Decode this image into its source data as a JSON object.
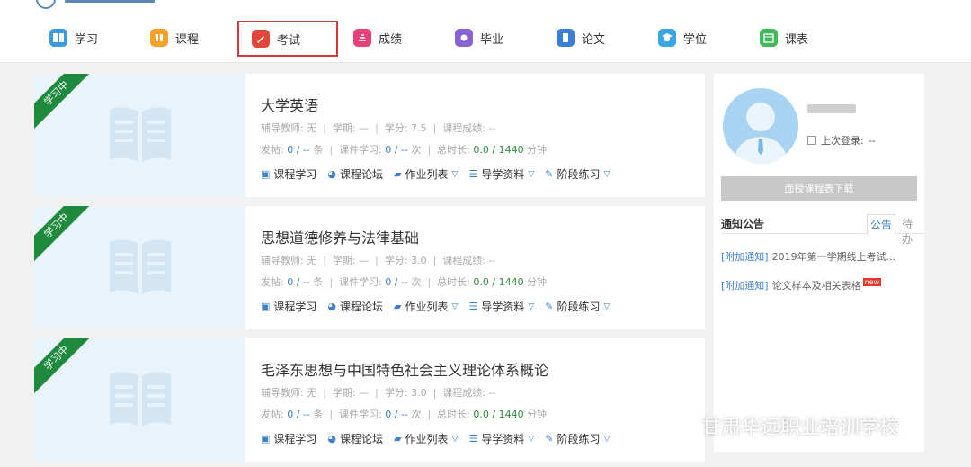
{
  "nav": {
    "items": [
      {
        "label": "学习",
        "icon": "book-icon",
        "color": "#3a9be0"
      },
      {
        "label": "课程",
        "icon": "course-icon",
        "color": "#f5a12a"
      },
      {
        "label": "考试",
        "icon": "pen-icon",
        "color": "#e0473a",
        "active": true
      },
      {
        "label": "成绩",
        "icon": "score-icon",
        "color": "#e63f7a"
      },
      {
        "label": "毕业",
        "icon": "graduation-icon",
        "color": "#8a63d2"
      },
      {
        "label": "论文",
        "icon": "paper-icon",
        "color": "#3a7fd5"
      },
      {
        "label": "学位",
        "icon": "cap-icon",
        "color": "#3aa5e0"
      },
      {
        "label": "课表",
        "icon": "calendar-icon",
        "color": "#43b85c"
      }
    ]
  },
  "courses": [
    {
      "status": "学习中",
      "title": "大学英语",
      "tutor_label": "辅导教师:",
      "tutor": "无",
      "term_label": "学期:",
      "term": "—",
      "credit_label": "学分:",
      "credit": "7.5",
      "grade_label": "课程成绩:",
      "grade": "--",
      "posts_label": "发帖:",
      "posts": "0 / --",
      "posts_unit": "条",
      "courseware_label": "课件学习:",
      "courseware": "0 / --",
      "courseware_unit": "次",
      "duration_label": "总时长:",
      "duration": "0.0 / 1440",
      "duration_unit": "分钟"
    },
    {
      "status": "学习中",
      "title": "思想道德修养与法律基础",
      "tutor_label": "辅导教师:",
      "tutor": "无",
      "term_label": "学期:",
      "term": "—",
      "credit_label": "学分:",
      "credit": "3.0",
      "grade_label": "课程成绩:",
      "grade": "--",
      "posts_label": "发帖:",
      "posts": "0 / --",
      "posts_unit": "条",
      "courseware_label": "课件学习:",
      "courseware": "0 / --",
      "courseware_unit": "次",
      "duration_label": "总时长:",
      "duration": "0.0 / 1440",
      "duration_unit": "分钟"
    },
    {
      "status": "学习中",
      "title": "毛泽东思想与中国特色社会主义理论体系概论",
      "tutor_label": "辅导教师:",
      "tutor": "无",
      "term_label": "学期:",
      "term": "—",
      "credit_label": "学分:",
      "credit": "3.0",
      "grade_label": "课程成绩:",
      "grade": "--",
      "posts_label": "发帖:",
      "posts": "0 / --",
      "posts_unit": "条",
      "courseware_label": "课件学习:",
      "courseware": "0 / --",
      "courseware_unit": "次",
      "duration_label": "总时长:",
      "duration": "0.0 / 1440",
      "duration_unit": "分钟"
    }
  ],
  "course_actions": {
    "study": "课程学习",
    "forum": "课程论坛",
    "homework": "作业列表",
    "guide": "导学资料",
    "practice": "阶段练习"
  },
  "sidebar": {
    "last_login_label": "上次登录:",
    "last_login_value": "--",
    "download_button": "面授课程表下载",
    "notice_title": "通知公告",
    "tab_announce": "公告",
    "tab_todo": "待办",
    "notices": [
      {
        "tag": "[附加通知]",
        "text": "2019年第一学期线上考试...",
        "is_new": false
      },
      {
        "tag": "[附加通知]",
        "text": "论文样本及相关表格",
        "is_new": true
      }
    ],
    "new_badge": "new"
  },
  "watermark": {
    "text": "甘肃华远职业培训学校",
    "icon": "wechat-icon"
  }
}
